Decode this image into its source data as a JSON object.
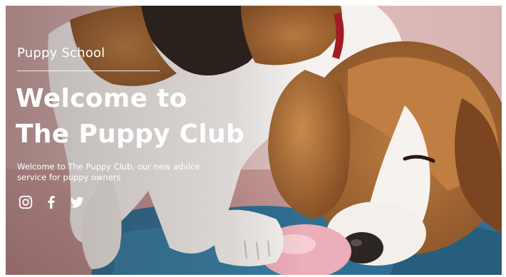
{
  "hero": {
    "brand": "Puppy School",
    "headline_line1": "Welcome to",
    "headline_line2": "The Puppy Club",
    "subtext": "Welcome to The Puppy Club, our new advice service for puppy owners"
  },
  "social": {
    "icons": [
      "instagram-icon",
      "facebook-icon",
      "twitter-icon"
    ]
  },
  "colors": {
    "text": "#ffffff",
    "backdrop": "#d9b8b8",
    "blanket": "#2f6f93"
  }
}
